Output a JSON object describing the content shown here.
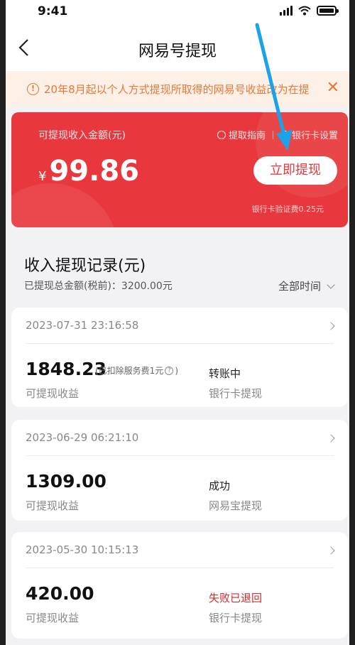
{
  "statusbar": {
    "time": "9:41"
  },
  "nav": {
    "title": "网易号提现"
  },
  "notice": {
    "text": "20年8月起以个人方式提现所取得的网易号收益改为在提"
  },
  "balance": {
    "label": "可提现收入金额(元)",
    "guide_link": "提取指南",
    "bank_settings_link": "银行卡设置",
    "currency": "¥",
    "amount": "99.86",
    "withdraw_button": "立即提现",
    "fee_note": "银行卡验证费0.25元"
  },
  "records_section": {
    "title": "收入提现记录(元)",
    "total": "已提现总金额(税前)：3200.00元",
    "filter_label": "全部时间"
  },
  "records": [
    {
      "date": "2023-07-31 23:16:58",
      "amount": "1848.23",
      "fee_note": "(已扣除服务费1元",
      "amount_label": "可提现收益",
      "status": "转账中",
      "method": "银行卡提现"
    },
    {
      "date": "2023-06-29 06:21:10",
      "amount": "1309.00",
      "amount_label": "可提现收益",
      "status": "成功",
      "method": "网易宝提现"
    },
    {
      "date": "2023-05-30 10:15:13",
      "amount": "420.00",
      "amount_label": "可提现收益",
      "status": "失败已退回",
      "method": "银行卡提现"
    }
  ],
  "colors": {
    "brand_red": "#e8383d",
    "notice_orange": "#e9773a",
    "fail_red": "#d52a2f",
    "annotation_blue": "#1aa3e8"
  }
}
